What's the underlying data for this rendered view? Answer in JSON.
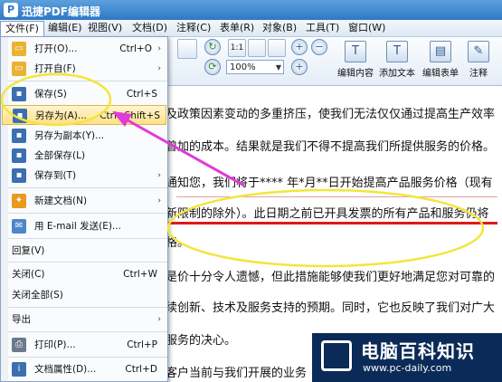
{
  "app": {
    "title": "迅捷PDF编辑器"
  },
  "menubar": [
    "文件(F)",
    "编辑(E)",
    "视图(V)",
    "文档(D)",
    "注释(C)",
    "表单(R)",
    "对象(B)",
    "工具(T)",
    "窗口(W)"
  ],
  "ribbon": {
    "zoom": "100%",
    "buttons": [
      "编辑内容",
      "添加文本",
      "编辑表单",
      "注释"
    ],
    "fit_label": "1:1"
  },
  "file_menu": {
    "items": [
      {
        "label": "打开(O)...",
        "key": "Ctrl+O",
        "arrow": "›",
        "icon": "folder-open-icon"
      },
      {
        "label": "打开自(F)",
        "key": "",
        "arrow": "›",
        "icon": "folder-icon"
      },
      {
        "label": "保存(S)",
        "key": "Ctrl+S",
        "arrow": "",
        "icon": "save-icon"
      },
      {
        "label": "另存为(A)...",
        "key": "Ctrl+Shift+S",
        "arrow": "",
        "icon": "save-as-icon"
      },
      {
        "label": "另存为副本(Y)...",
        "key": "",
        "arrow": "",
        "icon": "save-copy-icon"
      },
      {
        "label": "全部保存(L)",
        "key": "",
        "arrow": "",
        "icon": "save-all-icon"
      },
      {
        "label": "保存到(T)",
        "key": "",
        "arrow": "›",
        "icon": "save-to-icon"
      },
      {
        "label": "新建文档(N)",
        "key": "",
        "arrow": "›",
        "icon": "new-document-icon"
      },
      {
        "label": "用 E-mail 发送(E)...",
        "key": "",
        "arrow": "",
        "icon": "email-icon"
      },
      {
        "label": "回复(V)",
        "key": "",
        "arrow": "",
        "icon": ""
      },
      {
        "label": "关闭(C)",
        "key": "Ctrl+W",
        "arrow": "",
        "icon": ""
      },
      {
        "label": "关闭全部(S)",
        "key": "",
        "arrow": "",
        "icon": ""
      },
      {
        "label": "导出",
        "key": "",
        "arrow": "›",
        "icon": ""
      },
      {
        "label": "打印(P)...",
        "key": "Ctrl+P",
        "arrow": "",
        "icon": "print-icon"
      },
      {
        "label": "文档属性(D)...",
        "key": "Ctrl+D",
        "arrow": "",
        "icon": "info-icon"
      }
    ]
  },
  "document": {
    "lines": [
      "及政策因素变动的多重挤压，使我们无法仅仅通过提高生产效率",
      "曾加的成本。结果就是我们不得不提高我们所提供服务的价格。",
      "通知您，我们将于****  年*月**日开始提高产品服务价格（现有",
      "新限制的除外）。此日期之前已开具发票的所有产品和服务仍将",
      "格。",
      "是价十分令人遗憾，但此措施能够使我们更好地满足您对可靠的",
      "续创新、技术及服务支持的预期。同时，它也反映了我们对广大",
      "服务的决心。",
      "客户当前与我们开展的业务"
    ]
  },
  "watermark": {
    "title": "电脑百科知识",
    "url": "www.pc-daily.com"
  },
  "colors": {
    "highlight_circle": "#f2e63a",
    "arrow": "#e03ad8",
    "underline": "#e01818"
  }
}
